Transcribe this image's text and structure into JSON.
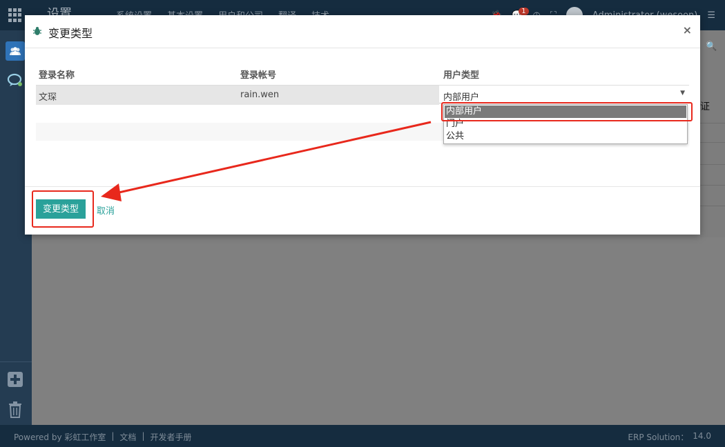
{
  "topbar": {
    "app_title": "设置",
    "menu": [
      "系统设置",
      "基本设置",
      "用户和公司",
      "翻译",
      "技术"
    ],
    "notification_count": "1",
    "user_name": "Administrator (wesoon)"
  },
  "modal": {
    "title": "变更类型",
    "close": "×",
    "columns": [
      "登录名称",
      "登录帐号",
      "用户类型"
    ],
    "rows": [
      {
        "name": "文琛",
        "login": "rain.wen",
        "user_type": "内部用户"
      }
    ],
    "dropdown_options": [
      "内部用户",
      "门户",
      "公共"
    ],
    "selected_option": "内部用户",
    "confirm_label": "变更类型",
    "cancel_label": "取消"
  },
  "footer": {
    "powered_by": "Powered by 彩虹工作室",
    "sep": "|",
    "docs": "文档",
    "dev_manual": "开发者手册",
    "erp_label": "ERP Solution：",
    "version": "14.0"
  },
  "partial_right_text": "证",
  "colors": {
    "primary": "#2aa19a",
    "nav": "#152c3f",
    "annotation": "#e8281c"
  }
}
